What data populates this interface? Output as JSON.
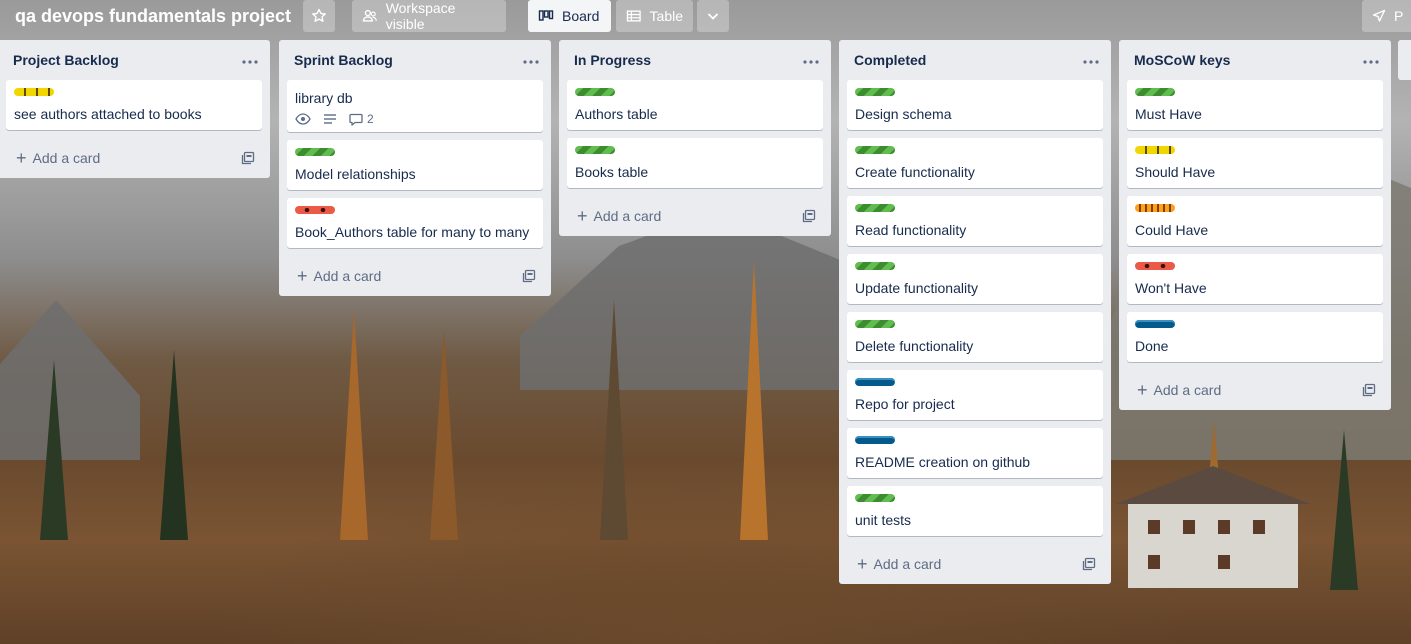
{
  "board": {
    "title": "qa devops fundamentals project",
    "visibility_label": "Workspace visible",
    "views": [
      {
        "label": "Board",
        "icon": "board-icon",
        "active": true
      },
      {
        "label": "Table",
        "icon": "table-icon",
        "active": false
      }
    ],
    "power_label": "P"
  },
  "footer": {
    "add_card_label": "Add a card"
  },
  "lists": [
    {
      "title": "Project Backlog",
      "cards": [
        {
          "label_color": "yellow",
          "title": "see authors attached to books"
        }
      ]
    },
    {
      "title": "Sprint Backlog",
      "cards": [
        {
          "label_color": "",
          "title": "library db",
          "comment_count": "2"
        },
        {
          "label_color": "green",
          "title": "Model relationships"
        },
        {
          "label_color": "red",
          "title": "Book_Authors table for many to many"
        }
      ]
    },
    {
      "title": "In Progress",
      "cards": [
        {
          "label_color": "green",
          "title": "Authors table"
        },
        {
          "label_color": "green",
          "title": "Books table"
        }
      ]
    },
    {
      "title": "Completed",
      "cards": [
        {
          "label_color": "green",
          "title": "Design schema"
        },
        {
          "label_color": "green",
          "title": "Create functionality"
        },
        {
          "label_color": "green",
          "title": "Read functionality"
        },
        {
          "label_color": "green",
          "title": "Update functionality"
        },
        {
          "label_color": "green",
          "title": "Delete functionality"
        },
        {
          "label_color": "blue",
          "title": "Repo for project"
        },
        {
          "label_color": "blue",
          "title": "README creation on github"
        },
        {
          "label_color": "green",
          "title": "unit tests"
        }
      ]
    },
    {
      "title": "MoSCoW keys",
      "cards": [
        {
          "label_color": "green",
          "title": "Must Have"
        },
        {
          "label_color": "yellow",
          "title": "Should Have"
        },
        {
          "label_color": "orange",
          "title": "Could Have"
        },
        {
          "label_color": "red",
          "title": "Won't Have"
        },
        {
          "label_color": "blue",
          "title": "Done"
        }
      ]
    }
  ]
}
